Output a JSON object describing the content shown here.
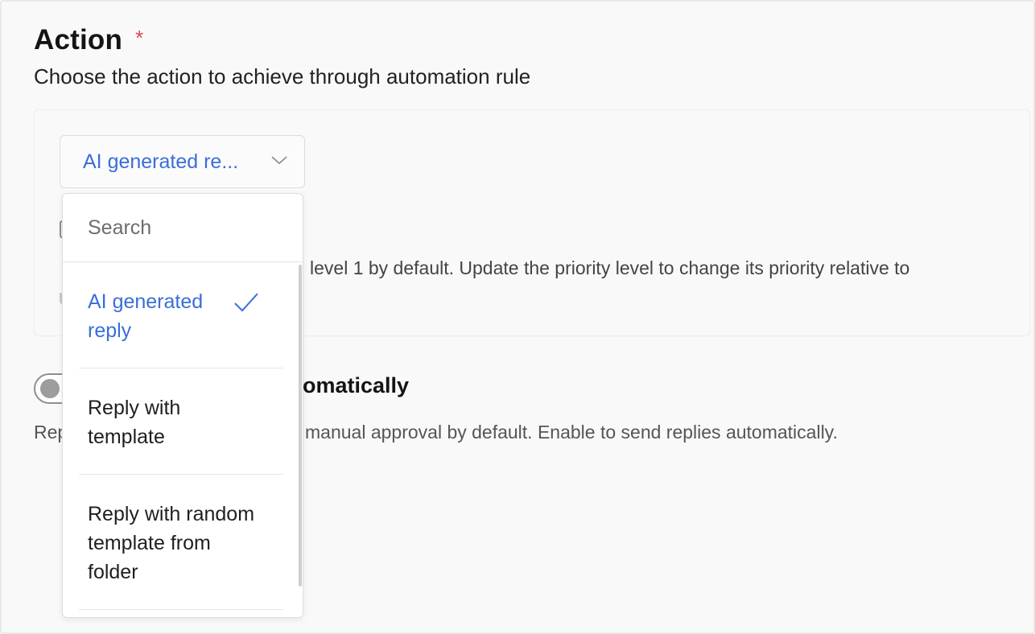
{
  "section": {
    "title": "Action",
    "required_marker": "*",
    "subtitle": "Choose the action to achieve through automation rule"
  },
  "action_select": {
    "selected_label": "AI generated re..."
  },
  "priority": {
    "description_visible": "level 1 by default. Update the priority level to change its priority relative to"
  },
  "auto_send": {
    "label_visible": "omatically",
    "description_left_visible": "Rep",
    "description_right_visible": "manual approval by default. Enable to send replies automatically.",
    "enabled": false
  },
  "dropdown": {
    "search_placeholder": "Search",
    "options": [
      {
        "line1": "AI generated",
        "line2": "reply",
        "selected": true
      },
      {
        "line1": "Reply with",
        "line2": "template",
        "selected": false
      },
      {
        "line1": "Reply with random",
        "line2": "template from",
        "line3": "folder",
        "selected": false
      }
    ]
  },
  "colors": {
    "accent": "#3a6ed8",
    "required": "#e0465b",
    "background": "#f9f9f9"
  },
  "icons": {
    "select_arrow": "chevron-down-icon",
    "selected_check": "check-icon"
  }
}
